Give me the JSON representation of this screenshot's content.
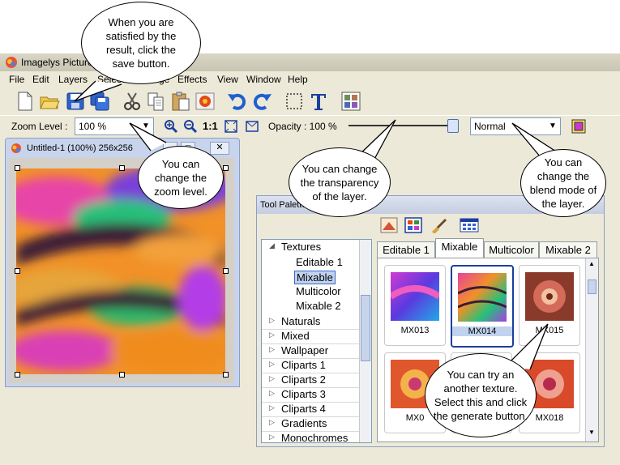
{
  "window": {
    "title": "Imagelys Picture S"
  },
  "menu": [
    "File",
    "Edit",
    "Layers",
    "Selection",
    "Image",
    "Effects",
    "View",
    "Window",
    "Help"
  ],
  "bar2": {
    "zoom_label": "Zoom Level :",
    "zoom_value": "100 %",
    "ratio": "1:1",
    "opacity_label": "Opacity : 100 %",
    "opacity": 1.0,
    "blend_value": "Normal"
  },
  "document": {
    "title": "Untitled-1 (100%) 256x256"
  },
  "palette": {
    "title": "Tool Palette",
    "tree": {
      "root": "Textures",
      "subs": [
        "Editable 1",
        "Mixable",
        "Multicolor",
        "Mixable 2"
      ],
      "selected_sub": "Mixable",
      "items": [
        "Naturals",
        "Mixed",
        "Wallpaper",
        "Cliparts 1",
        "Cliparts 2",
        "Cliparts 3",
        "Cliparts 4",
        "Gradients",
        "Monochromes"
      ]
    },
    "tabs": [
      "Editable 1",
      "Mixable",
      "Multicolor",
      "Mixable 2"
    ],
    "active_tab": "Mixable",
    "cells": [
      "MX013",
      "MX014",
      "MX015",
      "MX0",
      "",
      "MX018"
    ],
    "selected_cell": "MX014"
  },
  "callouts": {
    "save": "When you are satisfied by the result, click the save button.",
    "zoom": "You can change the zoom level.",
    "opacity": "You can change the transparency of the layer.",
    "blend": "You can change the blend mode of the layer.",
    "texture": "You can try an another texture. Select this and click the generate button."
  },
  "colors": {
    "accent": "#316ac5",
    "chrome": "#ece9d8",
    "selection": "#c1d2ee"
  }
}
